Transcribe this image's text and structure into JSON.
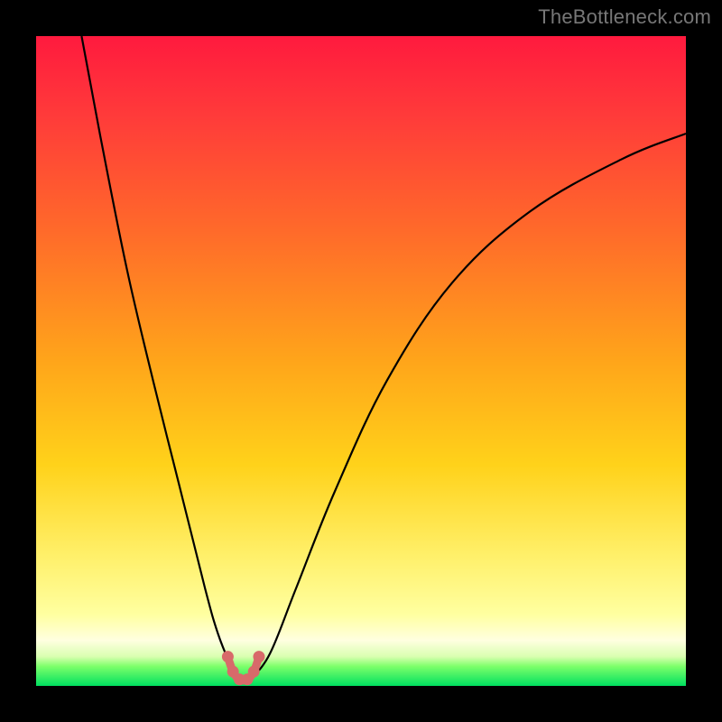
{
  "watermark": "TheBottleneck.com",
  "colors": {
    "frame": "#000000",
    "watermark": "#777777",
    "curve": "#000000",
    "marker": "#d86a6a"
  },
  "chart_data": {
    "type": "line",
    "title": "",
    "xlabel": "",
    "ylabel": "",
    "xlim": [
      0,
      100
    ],
    "ylim": [
      0,
      100
    ],
    "grid": false,
    "legend": false,
    "series": [
      {
        "name": "left-branch",
        "x": [
          7,
          10,
          14,
          18,
          22,
          26,
          28,
          30,
          31
        ],
        "values": [
          100,
          84,
          64,
          47,
          31,
          15,
          8,
          3,
          1
        ]
      },
      {
        "name": "right-branch",
        "x": [
          33,
          36,
          40,
          46,
          54,
          64,
          76,
          90,
          100
        ],
        "values": [
          1,
          5,
          15,
          30,
          47,
          62,
          73,
          81,
          85
        ]
      },
      {
        "name": "bottom-marker-arc",
        "x": [
          29.5,
          30.3,
          31.3,
          32.5,
          33.5,
          34.3
        ],
        "values": [
          4.5,
          2.2,
          1.0,
          1.0,
          2.2,
          4.5
        ]
      }
    ],
    "annotations": []
  }
}
